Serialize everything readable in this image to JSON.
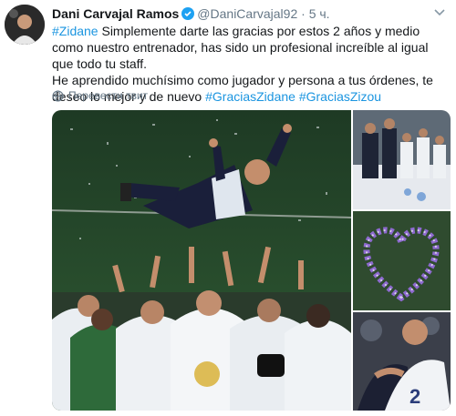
{
  "author": {
    "name": "Dani Carvajal Ramos",
    "handle": "@DaniCarvajal92",
    "separator": "·",
    "time": "5 ч."
  },
  "tweet": {
    "hashtag_zidane": "#Zidane",
    "line1_rest": " Simplemente darte las gracias por estos 2 años y medio como nuestro entrenador, has sido un profesional increíble al igual que todo tu staff.",
    "line2": "He aprendido muchísimo como jugador y persona a tus órdenes, te deseo lo mejor  y de nuevo ",
    "hashtag_gracias": "#GraciasZidane",
    "hashtag_zizou": "#GraciasZizou"
  },
  "translate_label": "Перевести твит",
  "colors": {
    "link": "#1b95e0",
    "verified": "#1da1f2",
    "muted": "#657786"
  },
  "icons": [
    "verified-badge-icon",
    "chevron-down-icon",
    "globe-icon"
  ]
}
